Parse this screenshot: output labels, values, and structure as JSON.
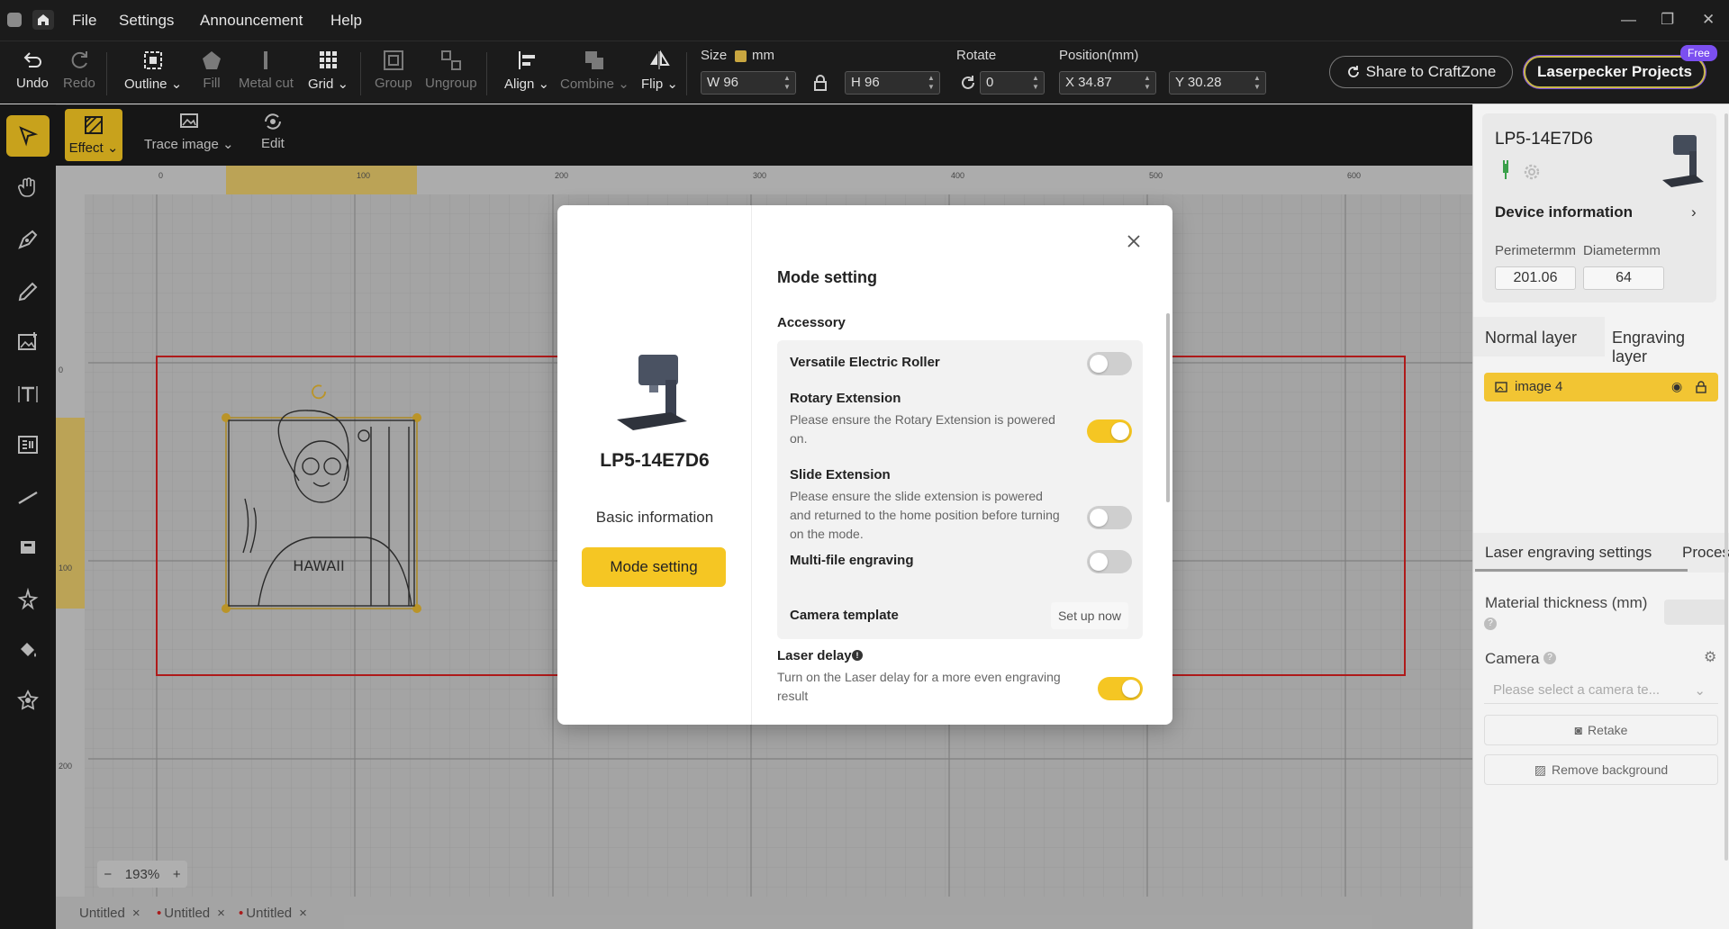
{
  "menu": {
    "items": [
      "File",
      "Settings",
      "Announcement",
      "Help"
    ]
  },
  "toolbar": {
    "undo": "Undo",
    "redo": "Redo",
    "outline": "Outline",
    "fill": "Fill",
    "metal_cut": "Metal cut",
    "grid": "Grid",
    "group": "Group",
    "ungroup": "Ungroup",
    "align": "Align",
    "combine": "Combine",
    "flip": "Flip",
    "size_label": "Size",
    "size_unit": "mm",
    "width": "W 96",
    "height": "H 96",
    "rotate_label": "Rotate",
    "rotate_value": "0",
    "position_label": "Position(mm)",
    "pos_x": "X 34.87",
    "pos_y": "Y 30.28",
    "share": "Share to CraftZone",
    "projects": "Laserpecker Projects",
    "free_badge": "Free"
  },
  "effectbar": {
    "effect": "Effect",
    "trace_image": "Trace image",
    "edit": "Edit"
  },
  "canvas": {
    "ruler_top": [
      "0",
      "100",
      "200",
      "300",
      "400",
      "500",
      "600"
    ],
    "ruler_left": [
      "0",
      "100",
      "200"
    ],
    "zoom": "193%",
    "tabs": [
      "Untitled",
      "Untitled",
      "Untitled"
    ]
  },
  "right_panel": {
    "device_name": "LP5-14E7D6",
    "device_info": "Device information",
    "perimeter_label": "Perimetermm",
    "perimeter_value": "201.06",
    "diameter_label": "Diametermm",
    "diameter_value": "64",
    "layer_tabs": [
      "Normal layer",
      "Engraving layer"
    ],
    "layer_item": "image 4",
    "settings_tabs": [
      "Laser engraving settings",
      "Proces"
    ],
    "material_thickness": "Material thickness (mm)",
    "camera_label": "Camera",
    "camera_placeholder": "Please select a camera te...",
    "retake": "Retake",
    "remove_background": "Remove background"
  },
  "dialog": {
    "device_name": "LP5-14E7D6",
    "basic_info": "Basic information",
    "mode_button": "Mode setting",
    "title": "Mode setting",
    "accessory_title": "Accessory",
    "options": [
      {
        "title": "Versatile Electric Roller",
        "desc": "",
        "state": "off"
      },
      {
        "title": "Rotary Extension",
        "desc": "Please ensure the Rotary Extension is powered on.",
        "state": "on"
      },
      {
        "title": "Slide Extension",
        "desc": "Please ensure the slide extension is powered and returned to the home position before turning on the mode.",
        "state": "off"
      },
      {
        "title": "Multi-file engraving",
        "desc": "",
        "state": "off"
      }
    ],
    "camera_template": "Camera template",
    "setup_now": "Set up now",
    "laser_delay_title": "Laser delay",
    "laser_delay_desc": "Turn on the Laser delay for a more even engraving result",
    "laser_delay_state": "on"
  },
  "colors": {
    "accent": "#f5c623",
    "dark": "#1b1b1b",
    "canvas": "#c9c9c9",
    "work_area": "#d62020",
    "purple": "#7b4ff0"
  }
}
